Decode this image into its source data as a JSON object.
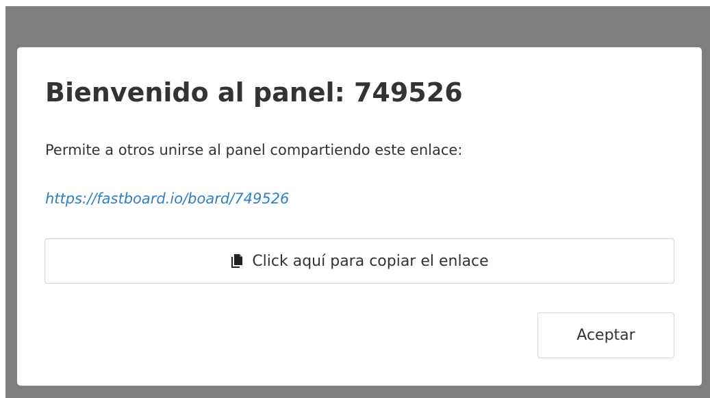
{
  "modal": {
    "title": "Bienvenido al panel: 749526",
    "description": "Permite a otros unirse al panel compartiendo este enlace:",
    "share_link": "https://fastboard.io/board/749526",
    "copy_button_label": "Click aquí para copiar el enlace",
    "copy_icon": "copy-icon",
    "accept_button_label": "Aceptar"
  },
  "colors": {
    "overlay": "#7f7f7f",
    "link": "#2f7fc4",
    "text": "#333333",
    "border": "#d4d4d4"
  }
}
